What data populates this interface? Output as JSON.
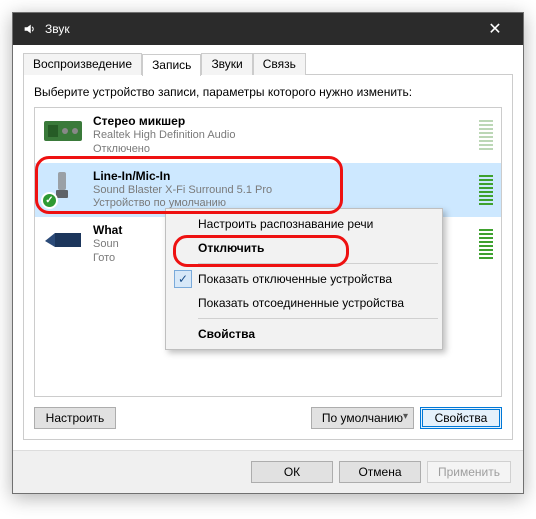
{
  "window": {
    "title": "Звук",
    "close_glyph": "✕"
  },
  "tabs": [
    {
      "label": "Воспроизведение",
      "active": false
    },
    {
      "label": "Запись",
      "active": true
    },
    {
      "label": "Звуки",
      "active": false
    },
    {
      "label": "Связь",
      "active": false
    }
  ],
  "prompt": "Выберите устройство записи, параметры которого нужно изменить:",
  "devices": [
    {
      "name": "Стерео микшер",
      "driver": "Realtek High Definition Audio",
      "status": "Отключено",
      "selected": false,
      "default": false,
      "meter": "faint"
    },
    {
      "name": "Line-In/Mic-In",
      "driver": "Sound Blaster X-Fi Surround 5.1 Pro",
      "status": "Устройство по умолчанию",
      "selected": true,
      "default": true,
      "meter": "active"
    },
    {
      "name": "What",
      "driver": "Soun",
      "status": "Гото",
      "selected": false,
      "default": false,
      "meter": "active"
    }
  ],
  "context_menu": {
    "items": [
      {
        "label": "Настроить распознавание речи",
        "checked": false,
        "bold": false
      },
      {
        "label": "Отключить",
        "checked": false,
        "bold": true
      },
      {
        "sep": true
      },
      {
        "label": "Показать отключенные устройства",
        "checked": true,
        "bold": false
      },
      {
        "label": "Показать отсоединенные устройства",
        "checked": false,
        "bold": false
      },
      {
        "sep": true
      },
      {
        "label": "Свойства",
        "checked": false,
        "bold": true
      }
    ]
  },
  "panel_buttons": {
    "configure": "Настроить",
    "set_default": "По умолчанию",
    "properties": "Свойства"
  },
  "dialog_buttons": {
    "ok": "ОК",
    "cancel": "Отмена",
    "apply": "Применить"
  }
}
